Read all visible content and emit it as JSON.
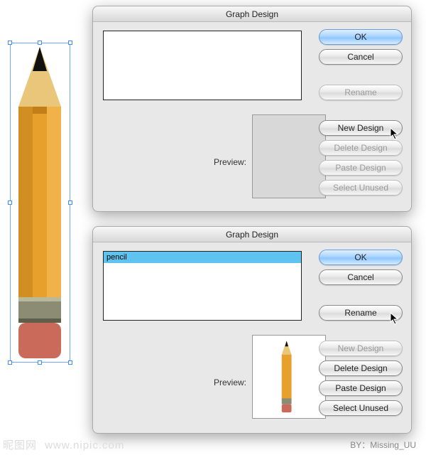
{
  "dialog1": {
    "title": "Graph Design",
    "preview_label": "Preview:",
    "list_items": [],
    "buttons": {
      "ok": "OK",
      "cancel": "Cancel",
      "rename": "Rename",
      "new_design": "New Design",
      "delete_design": "Delete Design",
      "paste_design": "Paste Design",
      "select_unused": "Select Unused"
    },
    "enabled": {
      "ok": true,
      "cancel": true,
      "rename": false,
      "new_design": true,
      "delete_design": false,
      "paste_design": false,
      "select_unused": false
    }
  },
  "dialog2": {
    "title": "Graph Design",
    "preview_label": "Preview:",
    "list_items": [
      "pencil"
    ],
    "selected_index": 0,
    "buttons": {
      "ok": "OK",
      "cancel": "Cancel",
      "rename": "Rename",
      "new_design": "New Design",
      "delete_design": "Delete Design",
      "paste_design": "Paste Design",
      "select_unused": "Select Unused"
    },
    "enabled": {
      "ok": true,
      "cancel": true,
      "rename": true,
      "new_design": false,
      "delete_design": true,
      "paste_design": true,
      "select_unused": true
    }
  },
  "watermark": {
    "site": "昵图网",
    "url": "www.nipic.com"
  },
  "credit": "BY：Missing_UU",
  "colors": {
    "selection": "#5ec4ef",
    "aqua_button": "#a9d4ff",
    "handle": "#3d8bff"
  }
}
